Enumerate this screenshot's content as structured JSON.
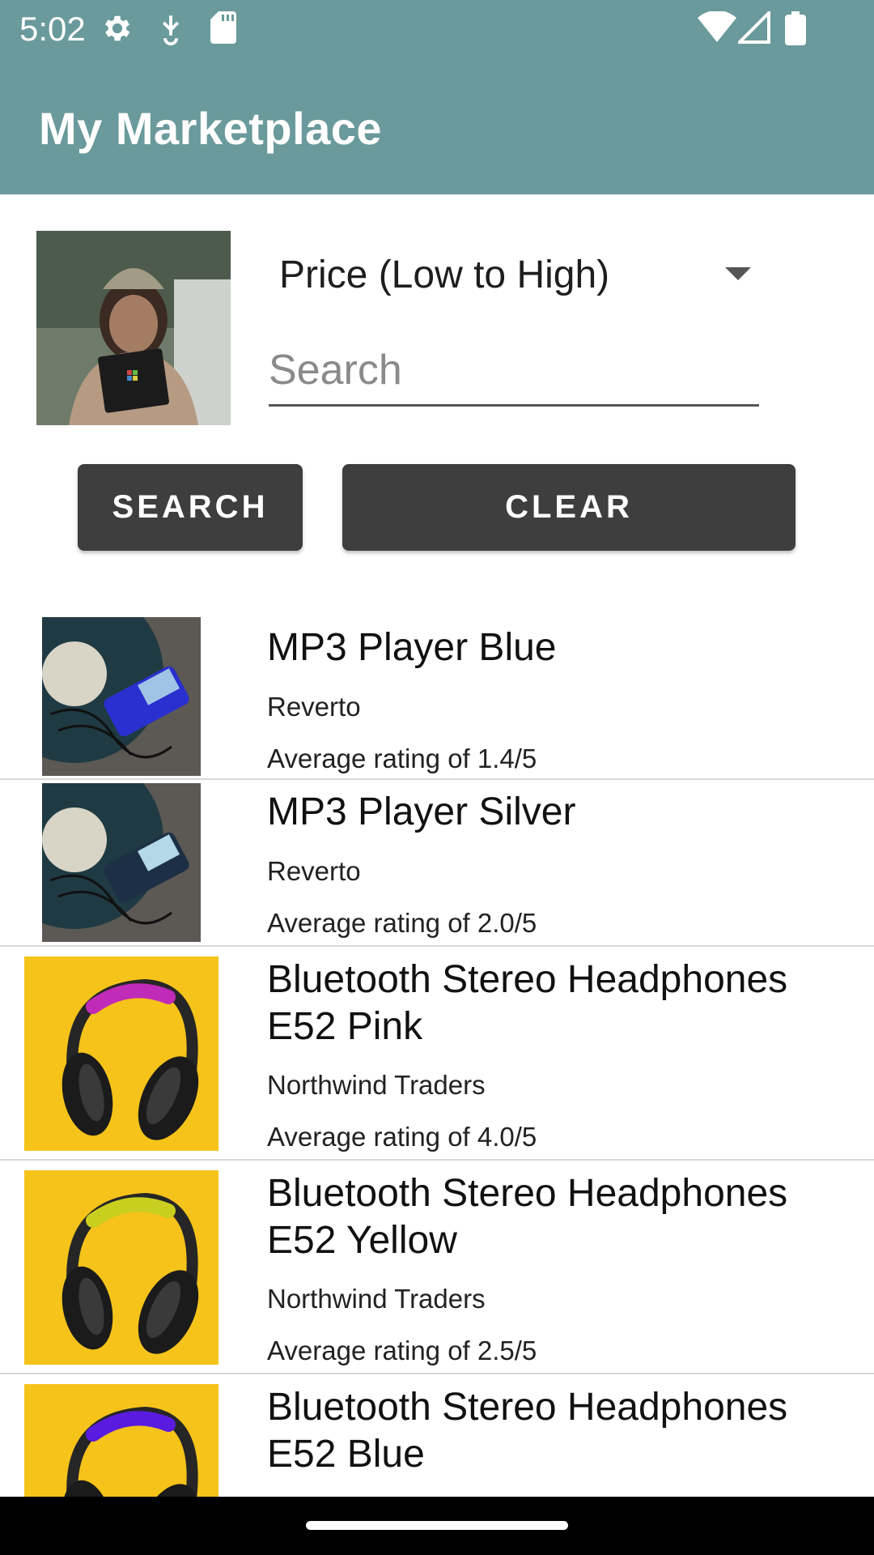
{
  "status_bar": {
    "time": "5:02"
  },
  "app": {
    "title": "My Marketplace"
  },
  "controls": {
    "sort_selected": "Price (Low to High)",
    "search_placeholder": "Search",
    "search_value": "",
    "search_button": "SEARCH",
    "clear_button": "CLEAR"
  },
  "products": [
    {
      "name": "MP3 Player Blue",
      "brand": "Reverto",
      "rating": "Average rating of 1.4/5",
      "image": "mp3-player-blue"
    },
    {
      "name": "MP3 Player Silver",
      "brand": "Reverto",
      "rating": "Average rating of 2.0/5",
      "image": "mp3-player-silver"
    },
    {
      "name": "Bluetooth Stereo Headphones E52 Pink",
      "brand": "Northwind Traders",
      "rating": "Average rating of 4.0/5",
      "image": "headphones-pink"
    },
    {
      "name": "Bluetooth Stereo Headphones E52 Yellow",
      "brand": "Northwind Traders",
      "rating": "Average rating of 2.5/5",
      "image": "headphones-yellow"
    },
    {
      "name": "Bluetooth Stereo Headphones E52 Blue",
      "brand": "",
      "rating": "",
      "image": "headphones-blue"
    }
  ],
  "colors": {
    "app_bar": "#6a9a9b",
    "button": "#3e3e3e",
    "headphone_bg": "#f5c31a",
    "band_pink": "#c02bb8",
    "band_yellow": "#c9cf1e",
    "band_blue": "#5a1be0"
  }
}
